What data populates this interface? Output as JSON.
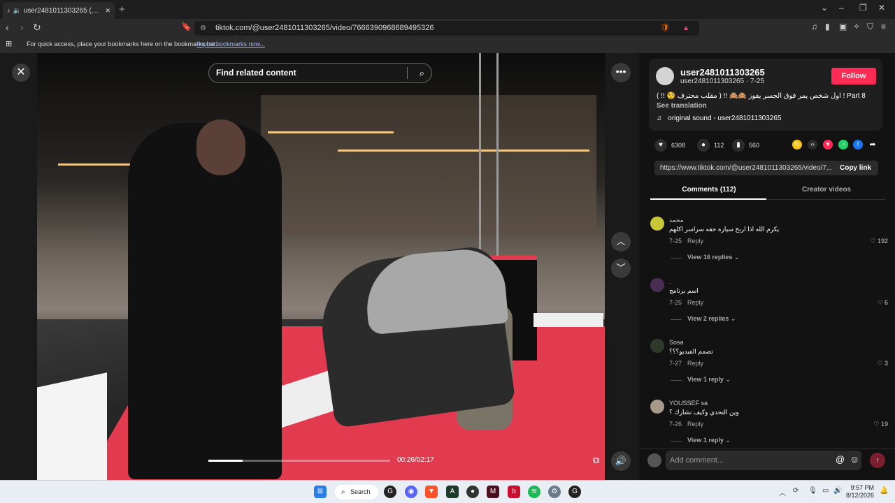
{
  "browser": {
    "tab_title": "user2481011303265 (@user2…",
    "new_tab": "+",
    "url": "tiktok.com/@user2481011303265/video/7666390968689495326",
    "bookmarks_msg": "For quick access, place your bookmarks here on the bookmarks bar.",
    "bookmarks_link": "Import bookmarks now...",
    "icons": [
      "back-icon",
      "forward-icon",
      "reload-icon",
      "bookmark-icon",
      "site-info-icon",
      "brave-shield-icon",
      "rewards-icon",
      "media-icon",
      "sidebar-icon",
      "wallet-icon",
      "leo-icon",
      "vpn-icon",
      "menu-icon"
    ]
  },
  "player": {
    "search_placeholder": "Find related content",
    "time": "00:26/02:17",
    "progress_fraction": 0.19,
    "close": "✕",
    "more": "•••",
    "up": "︿",
    "down": "﹀",
    "volume": "🔊",
    "pip": "⧉"
  },
  "author": {
    "username": "user2481011303265",
    "subline": "user2481011303265 · 7-25",
    "follow": "Follow",
    "caption": "( !! 🧐 مقلب محترف ) !! 🙈🙈 اول شخص يمر فوق الجسر يفوز ! Part 8",
    "see_translation": "See translation",
    "sound": "original sound - user2481011303265"
  },
  "stats": {
    "likes": "6308",
    "comments": "112",
    "saves": "560"
  },
  "share_link": {
    "url": "https://www.tiktok.com/@user2481011303265/video/7...",
    "copy": "Copy link"
  },
  "tabs": {
    "comments": "Comments (112)",
    "creator": "Creator videos"
  },
  "comments": [
    {
      "name": "محمد",
      "text": "يكرم الله اذا اربح سياره حقه سراسر اكلهم",
      "date": "7-25",
      "reply": "Reply",
      "likes": "192",
      "view": "View 16 replies",
      "avatar_color": "#c9c63a"
    },
    {
      "name": ".",
      "text": "اسم برنامج",
      "date": "7-25",
      "reply": "Reply",
      "likes": "6",
      "view": "View 2 replies",
      "avatar_color": "#4a2d52"
    },
    {
      "name": "Sosa",
      "text": "تصمم الفيديو؟؟؟",
      "date": "7-27",
      "reply": "Reply",
      "likes": "3",
      "view": "View 1 reply",
      "avatar_color": "#2f3a2a"
    },
    {
      "name": "YOUSSEF sa",
      "text": "وين التحدي وكيف نشارك ؟",
      "date": "7-26",
      "reply": "Reply",
      "likes": "19",
      "view": "View 1 reply",
      "avatar_color": "#a89a8a"
    }
  ],
  "comment_bar": {
    "placeholder": "Add comment...",
    "at": "@",
    "emoji": "☺",
    "post": "↑"
  },
  "taskbar": {
    "search": "Search",
    "time": "9:57 PM",
    "date": "8/12/2026",
    "apps": [
      "windows-start-icon",
      "search-icon",
      "app-g-icon",
      "discord-icon",
      "brave-icon",
      "app-a-icon",
      "app-bubble-icon",
      "app-m-icon",
      "app-b-icon",
      "spotify-icon",
      "settings-icon",
      "app-g2-icon"
    ]
  }
}
